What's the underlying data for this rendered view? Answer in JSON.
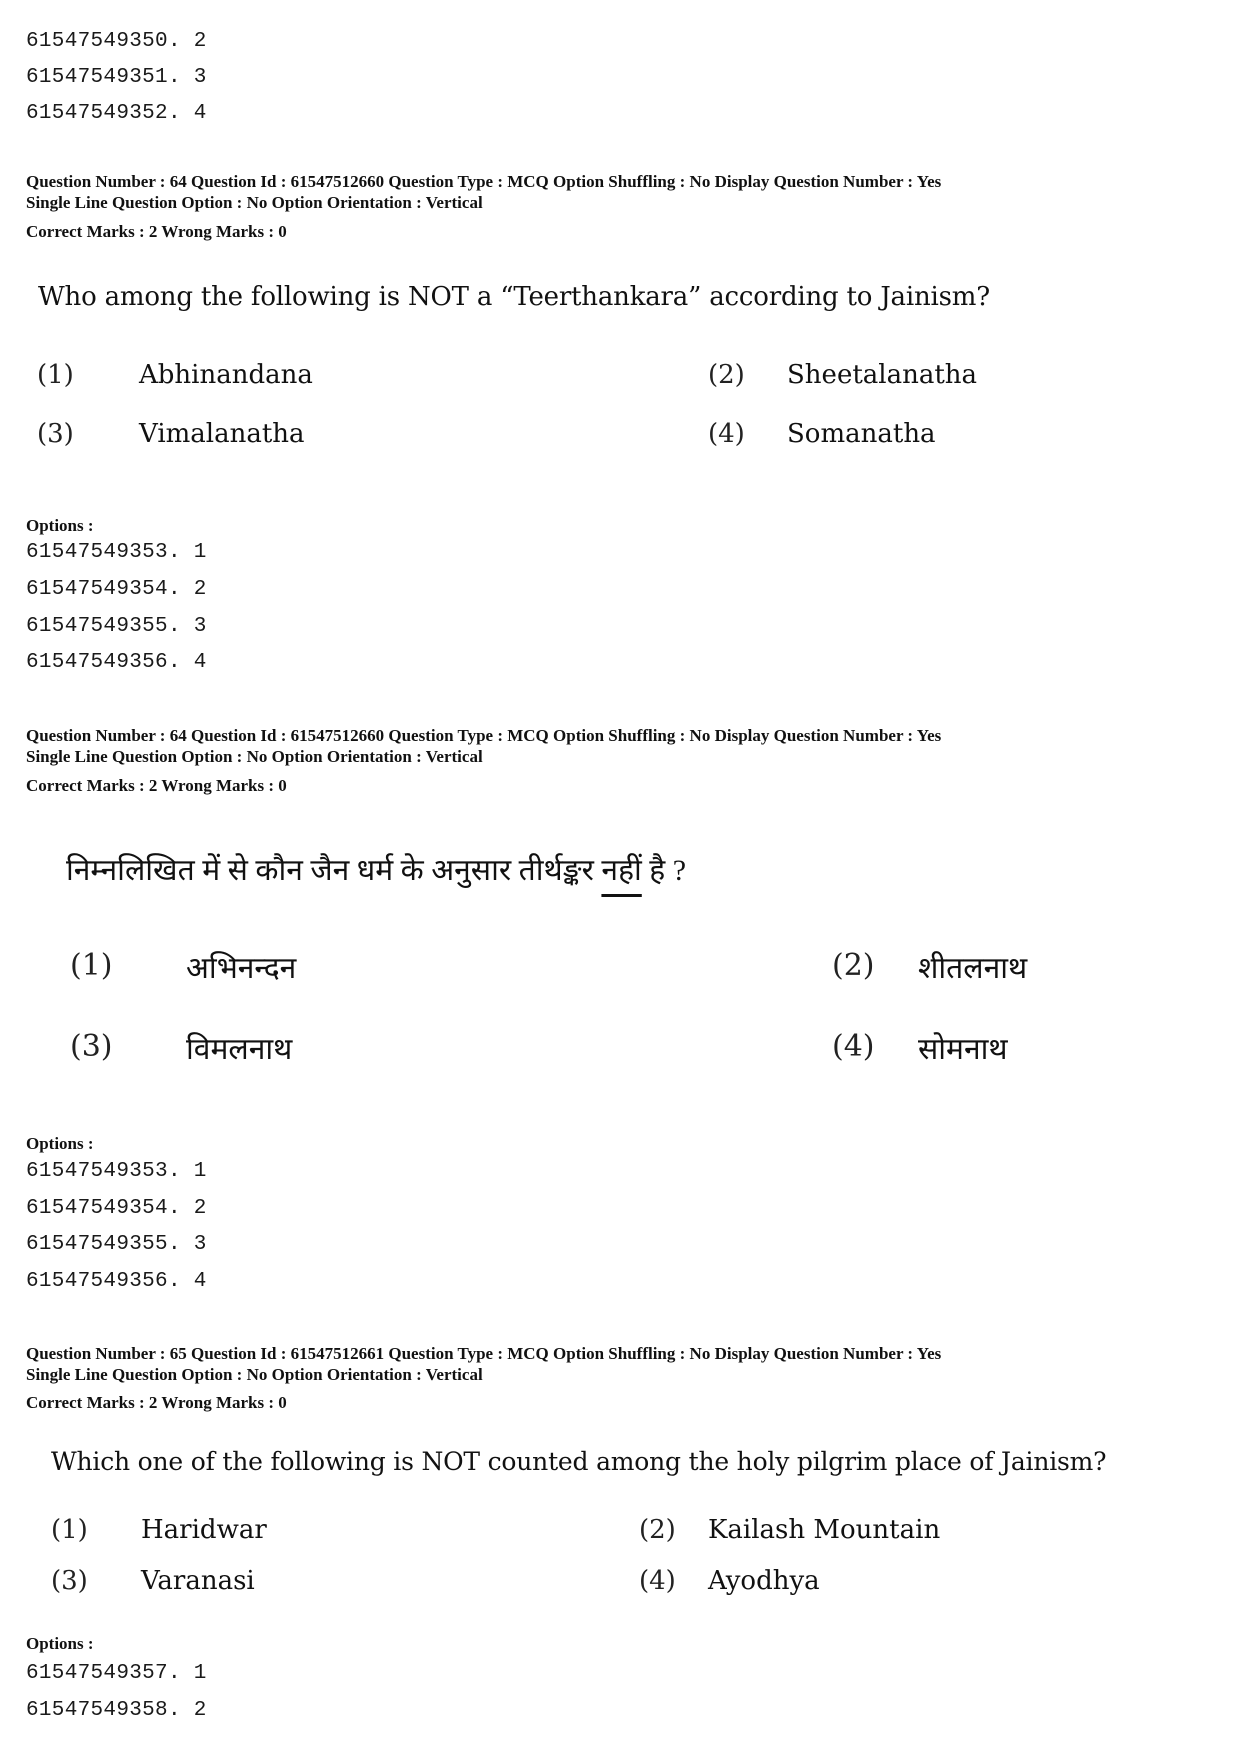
{
  "top_options": [
    {
      "id": "61547549350",
      "num": "2"
    },
    {
      "id": "61547549351",
      "num": "3"
    },
    {
      "id": "61547549352",
      "num": "4"
    }
  ],
  "blocks": [
    {
      "meta_line1": "Question Number : 64  Question Id : 61547512660  Question Type : MCQ  Option Shuffling : No  Display Question Number : Yes",
      "meta_line2": "Single Line Question Option : No  Option Orientation : Vertical",
      "marks": "Correct Marks : 2  Wrong Marks : 0",
      "question": "Who among the following is NOT a “Teerthankara” according to Jainism?",
      "choices": [
        {
          "num": "(1)",
          "text": "Abhinandana"
        },
        {
          "num": "(2)",
          "text": "Sheetalanatha"
        },
        {
          "num": "(3)",
          "text": "Vimalanatha"
        },
        {
          "num": "(4)",
          "text": "Somanatha"
        }
      ],
      "options_label": "Options :",
      "options": [
        {
          "id": "61547549353",
          "num": "1"
        },
        {
          "id": "61547549354",
          "num": "2"
        },
        {
          "id": "61547549355",
          "num": "3"
        },
        {
          "id": "61547549356",
          "num": "4"
        }
      ]
    },
    {
      "meta_line1": "Question Number : 64  Question Id : 61547512660  Question Type : MCQ  Option Shuffling : No  Display Question Number : Yes",
      "meta_line2": "Single Line Question Option : No  Option Orientation : Vertical",
      "marks": "Correct Marks : 2  Wrong Marks : 0",
      "question_before": "निम्नलिखित में से कौन जैन धर्म के अनुसार तीर्थङ्कर ",
      "question_underlined": "नहीं",
      "question_after": " है ?",
      "choices": [
        {
          "num": "(1)",
          "text": "अभिनन्दन"
        },
        {
          "num": "(2)",
          "text": "शीतलनाथ"
        },
        {
          "num": "(3)",
          "text": "विमलनाथ"
        },
        {
          "num": "(4)",
          "text": "सोमनाथ"
        }
      ],
      "options_label": "Options :",
      "options": [
        {
          "id": "61547549353",
          "num": "1"
        },
        {
          "id": "61547549354",
          "num": "2"
        },
        {
          "id": "61547549355",
          "num": "3"
        },
        {
          "id": "61547549356",
          "num": "4"
        }
      ]
    },
    {
      "meta_line1": "Question Number : 65  Question Id : 61547512661  Question Type : MCQ  Option Shuffling : No  Display Question Number : Yes",
      "meta_line2": "Single Line Question Option : No  Option Orientation : Vertical",
      "marks": "Correct Marks : 2  Wrong Marks : 0",
      "question": "Which one of the following is NOT counted among the holy pilgrim place of Jainism?",
      "choices": [
        {
          "num": "(1)",
          "text": "Haridwar"
        },
        {
          "num": "(2)",
          "text": "Kailash Mountain"
        },
        {
          "num": "(3)",
          "text": "Varanasi"
        },
        {
          "num": "(4)",
          "text": "Ayodhya"
        }
      ],
      "options_label": "Options :",
      "options": [
        {
          "id": "61547549357",
          "num": "1"
        },
        {
          "id": "61547549358",
          "num": "2"
        }
      ]
    }
  ]
}
